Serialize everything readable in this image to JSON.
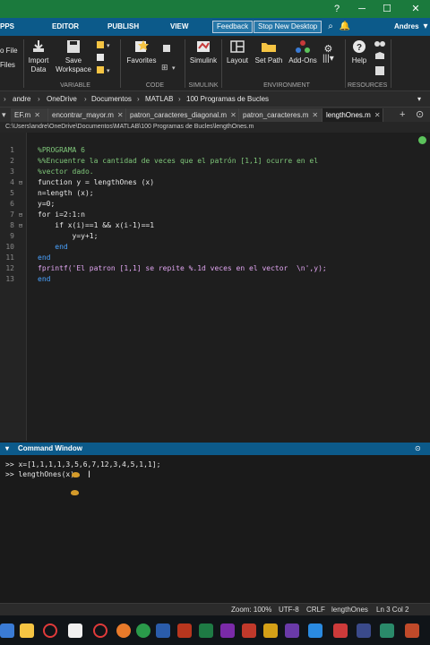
{
  "ribbon_tabs": {
    "apps": "PPS",
    "editor": "EDITOR",
    "publish": "PUBLISH",
    "view": "VIEW"
  },
  "header_buttons": {
    "feedback": "Feedback",
    "stop_desktop": "Stop New Desktop",
    "user": "Andres"
  },
  "ribbon": {
    "file_items": [
      "o File",
      "Files"
    ],
    "import": "Import\nData",
    "save_ws": "Save\nWorkspace",
    "favorites": "Favorites",
    "simulink": "Simulink",
    "layout": "Layout",
    "set_path": "Set Path",
    "addons": "Add-Ons",
    "help": "Help",
    "groups": {
      "variable": "VARIABLE",
      "code": "CODE",
      "simulink": "SIMULINK",
      "environment": "ENVIRONMENT",
      "resources": "RESOURCES"
    }
  },
  "breadcrumb": [
    "andre",
    "OneDrive",
    "Documentos",
    "MATLAB",
    "100 Programas de Bucles"
  ],
  "editor_tabs": [
    "EF.m",
    "encontrar_mayor.m",
    "patron_caracteres_diagonal.m",
    "patron_caracteres.m",
    "lengthOnes.m"
  ],
  "file_path": "C:\\Users\\andre\\OneDrive\\Documentos\\MATLAB\\100 Programas de Bucles\\lengthOnes.m",
  "code_lines": [
    {
      "n": "1",
      "text": "%PROGRAMA 6"
    },
    {
      "n": "2",
      "text": "%%Encuentre la cantidad de veces que el patrón [1,1] ocurre en el"
    },
    {
      "n": "3",
      "text": "%vector dado."
    },
    {
      "n": "4",
      "text": "function y = lengthOnes (x)"
    },
    {
      "n": "5",
      "text": "n=length (x);"
    },
    {
      "n": "6",
      "text": "y=0;"
    },
    {
      "n": "7",
      "text": "for i=2:1:n"
    },
    {
      "n": "8",
      "text": "    if x(i)==1 && x(i-1)==1"
    },
    {
      "n": "9",
      "text": "        y=y+1;"
    },
    {
      "n": "10",
      "text": "    end"
    },
    {
      "n": "11",
      "text": "end"
    },
    {
      "n": "12",
      "text": "fprintf('El patron [1,1] se repite %.1d veces en el vector  \\n',y);"
    },
    {
      "n": "13",
      "text": "end"
    }
  ],
  "command_window": {
    "title": "Command Window",
    "lines": [
      ">> x=[1,1,1,1,3,5,6,7,12,3,4,5,1,1];",
      ">> lengthOnes(x)"
    ]
  },
  "status": {
    "zoom": "Zoom: 100%",
    "encoding": "UTF-8",
    "eol": "CRLF",
    "func": "lengthOnes",
    "pos": "Ln 3 Col 2"
  },
  "colors": {
    "accent": "#0c5a8a",
    "titlebar": "#1b7a3d",
    "comment": "#7fc77a",
    "keyword": "#4aa3ff",
    "string": "#e0a5f0"
  }
}
